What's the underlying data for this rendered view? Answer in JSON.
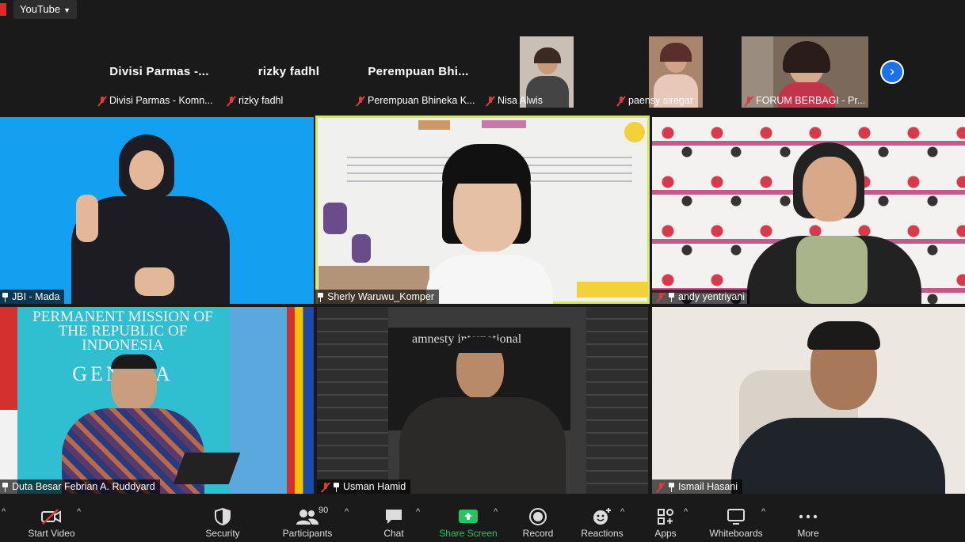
{
  "topbar": {
    "stream_label": "YouTube"
  },
  "filmstrip": {
    "tiles": [
      {
        "big_name": "Divisi  Parmas  -...",
        "footer": "Divisi Parmas - Komn..."
      },
      {
        "big_name": "rizky  fadhl",
        "footer": "rizky fadhl"
      },
      {
        "big_name": "Perempuan  Bhi...",
        "footer": "Perempuan Bhineka K..."
      },
      {
        "footer": "Nisa Alwis"
      },
      {
        "footer": "paensy siregar"
      },
      {
        "footer": "FORUM BERBAGI - Pr..."
      }
    ]
  },
  "grid": {
    "tiles": [
      {
        "name": "JBI - Mada"
      },
      {
        "name": "Sherly Waruwu_Komper"
      },
      {
        "name": "andy yentriyani"
      },
      {
        "name": "Duta Besar Febrian A. Ruddyard"
      },
      {
        "name": "Usman Hamid"
      },
      {
        "name": "Ismail Hasani"
      }
    ],
    "backdrop_text": {
      "mission_line1": "PERMANENT MISSION OF",
      "mission_line2": "THE REPUBLIC OF INDONESIA",
      "mission_city": "GENEVA",
      "amnesty": "amnesty international"
    }
  },
  "toolbar": {
    "start_video": "Start Video",
    "security": "Security",
    "participants": "Participants",
    "participants_count": "90",
    "chat": "Chat",
    "share_screen": "Share Screen",
    "record": "Record",
    "reactions": "Reactions",
    "apps": "Apps",
    "whiteboards": "Whiteboards",
    "more": "More"
  },
  "colors": {
    "accent_blue": "#1a73e8",
    "share_green": "#22c55e",
    "active_speaker": "#d7e85c",
    "muted_red": "#e03a3a"
  }
}
